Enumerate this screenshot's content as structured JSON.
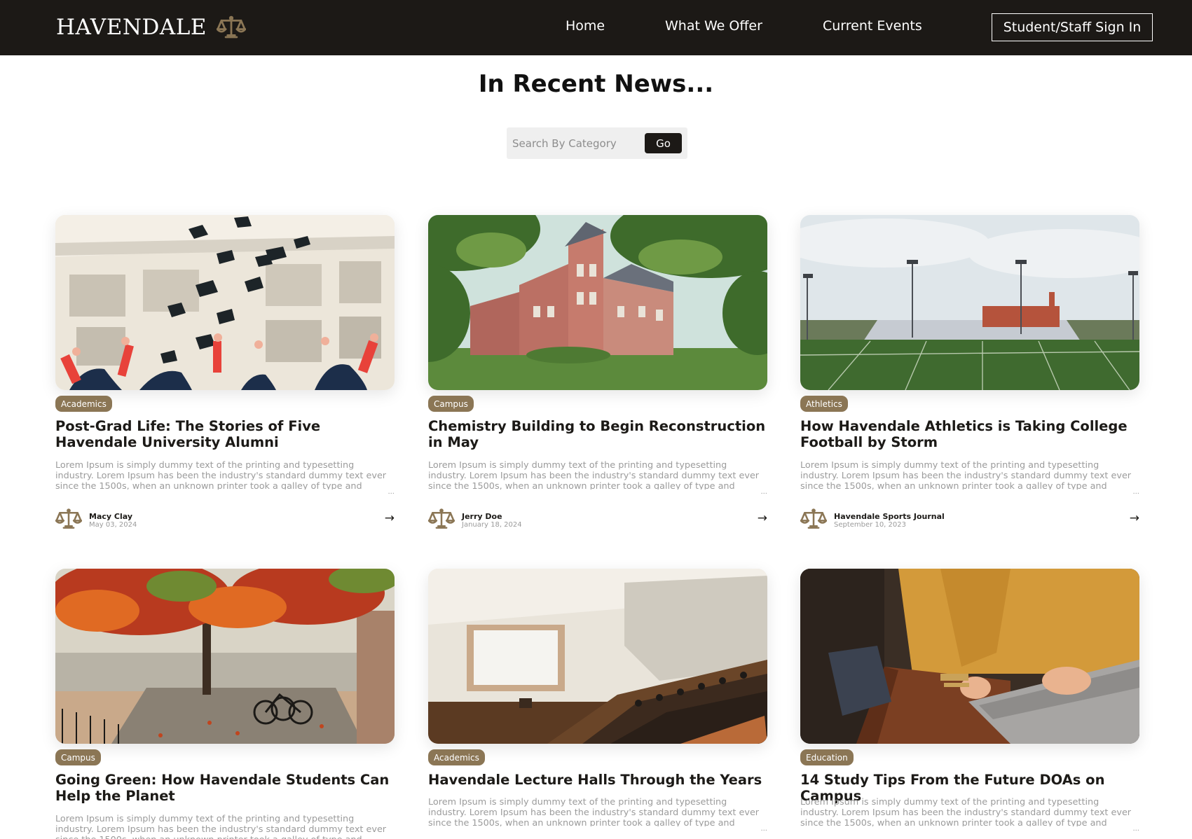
{
  "brand": {
    "name": "HAVENDALE",
    "icon": "scales-icon",
    "accent": "#8b7655"
  },
  "nav": {
    "items": [
      {
        "label": "Home"
      },
      {
        "label": "What We Offer"
      },
      {
        "label": "Current Events"
      }
    ],
    "signin_label": "Student/Staff Sign In",
    "background": "#1c1916"
  },
  "page_title": "In Recent News...",
  "search": {
    "placeholder": "Search By Category",
    "button_label": "Go"
  },
  "articles": [
    {
      "category": "Academics",
      "title": "Post-Grad Life: The Stories of Five Havendale University Alumni",
      "excerpt": "Lorem Ipsum is simply dummy text of the printing and typesetting industry. Lorem Ipsum has been the industry's standard dummy text ever since the 1500s, when an unknown printer took a galley of type and scrambled it to make a type specimen book.",
      "ellipsis": "...",
      "author": "Macy Clay",
      "date": "May 03, 2024",
      "arrow": "→"
    },
    {
      "category": "Campus",
      "title": "Chemistry Building to Begin Reconstruction in May",
      "excerpt": "Lorem Ipsum is simply dummy text of the printing and typesetting industry. Lorem Ipsum has been the industry's standard dummy text ever since the 1500s, when an unknown printer took a galley of type and scrambled it to make a type specimen book.",
      "ellipsis": "...",
      "author": "Jerry Doe",
      "date": "January 18, 2024",
      "arrow": "→"
    },
    {
      "category": "Athletics",
      "title": "How Havendale Athletics is Taking College Football by Storm",
      "excerpt": "Lorem Ipsum is simply dummy text of the printing and typesetting industry. Lorem Ipsum has been the industry's standard dummy text ever since the 1500s, when an unknown printer took a galley of type and scrambled it to make a type specimen book.",
      "ellipsis": "...",
      "author": "Havendale Sports Journal",
      "date": "September 10, 2023",
      "arrow": "→"
    },
    {
      "category": "Campus",
      "title": "Going Green: How Havendale Students Can Help the Planet",
      "excerpt": "Lorem Ipsum is simply dummy text of the printing and typesetting industry. Lorem Ipsum has been the industry's standard dummy text ever since the 1500s, when an unknown printer took a galley of type and scrambled it to make a type specimen book.",
      "ellipsis": "..."
    },
    {
      "category": "Academics",
      "title": "Havendale Lecture Halls Through the Years",
      "excerpt": "Lorem Ipsum is simply dummy text of the printing and typesetting industry. Lorem Ipsum has been the industry's standard dummy text ever since the 1500s, when an unknown printer took a galley of type and scrambled it to make a type specimen book.",
      "ellipsis": "..."
    },
    {
      "category": "Education",
      "title": "14 Study Tips From the Future DOAs on Campus",
      "excerpt": "Lorem Ipsum is simply dummy text of the printing and typesetting industry. Lorem Ipsum has been the industry's standard dummy text ever since the 1500s, when an unknown printer took a galley of type and scrambled it to make a type specimen book.",
      "ellipsis": "..."
    }
  ]
}
